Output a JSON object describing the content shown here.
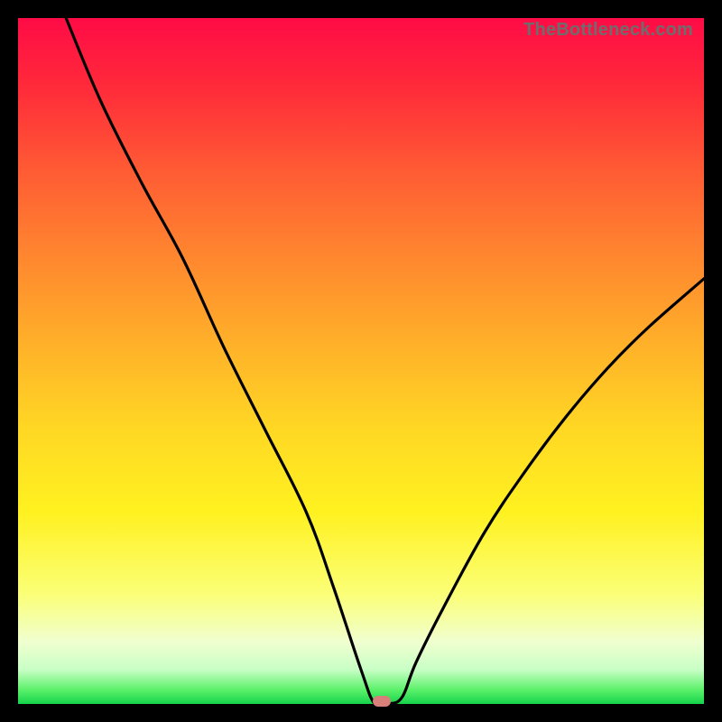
{
  "watermark": "TheBottleneck.com",
  "chart_data": {
    "type": "line",
    "title": "",
    "xlabel": "",
    "ylabel": "",
    "xlim": [
      0,
      100
    ],
    "ylim": [
      0,
      100
    ],
    "grid": false,
    "legend": false,
    "marker": {
      "x": 53,
      "y": 0,
      "color": "#d97f7a"
    },
    "series": [
      {
        "name": "curve",
        "color": "#000000",
        "x": [
          7,
          12,
          18,
          24,
          30,
          36,
          42,
          46,
          50,
          52,
          54,
          56,
          58,
          62,
          68,
          74,
          80,
          86,
          92,
          100
        ],
        "values": [
          100,
          88,
          76,
          65,
          52,
          40,
          28,
          17,
          5,
          0,
          0,
          1,
          6,
          14,
          25,
          34,
          42,
          49,
          55,
          62
        ]
      }
    ]
  }
}
